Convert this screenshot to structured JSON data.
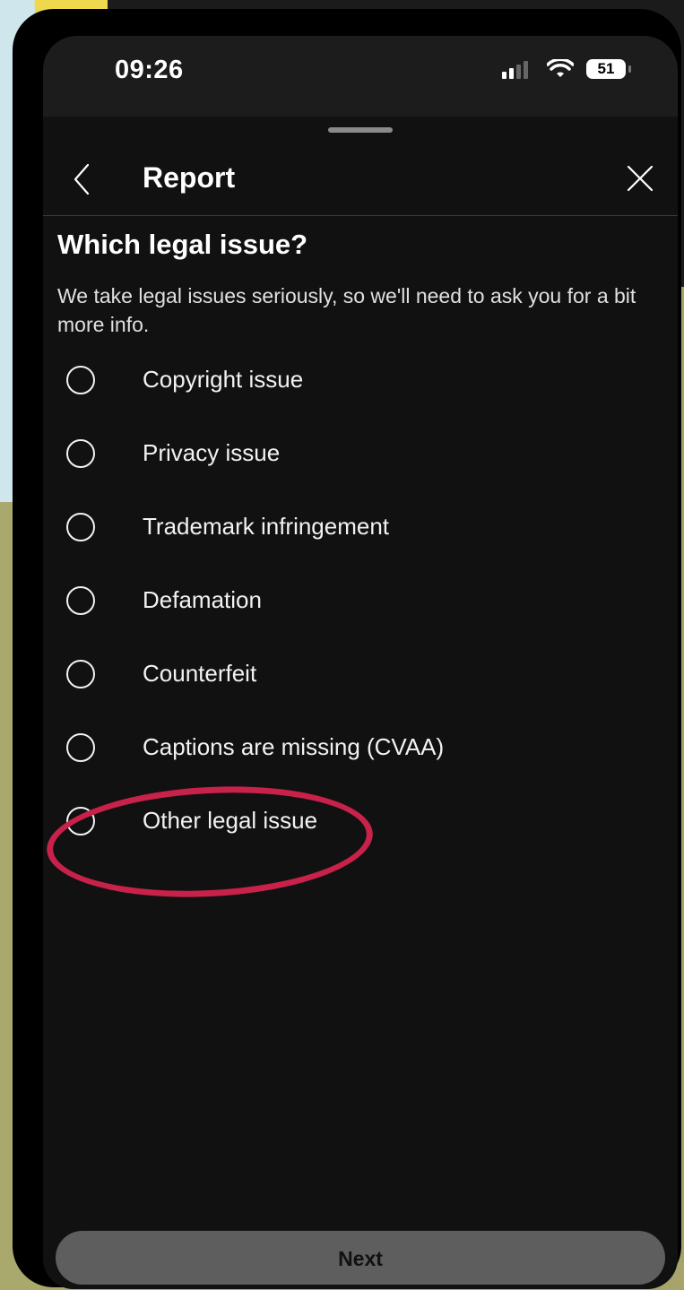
{
  "status_bar": {
    "time": "09:26",
    "battery_level": "51"
  },
  "header": {
    "title": "Report",
    "back_icon": "chevron-left-icon",
    "close_icon": "close-icon"
  },
  "question": "Which legal issue?",
  "description": "We take legal issues seriously, so we'll need to ask you for a bit more info.",
  "options": [
    {
      "label": "Copyright issue",
      "selected": false
    },
    {
      "label": "Privacy issue",
      "selected": false
    },
    {
      "label": "Trademark infringement",
      "selected": false
    },
    {
      "label": "Defamation",
      "selected": false
    },
    {
      "label": "Counterfeit",
      "selected": false
    },
    {
      "label": "Captions are missing (CVAA)",
      "selected": false
    },
    {
      "label": "Other legal issue",
      "selected": false
    }
  ],
  "highlighted_option": "Other legal issue",
  "next_button": {
    "label": "Next",
    "enabled": false
  },
  "colors": {
    "background": "#111111",
    "highlight_ring": "#c8214a",
    "next_button_bg": "#5e5e5e"
  }
}
